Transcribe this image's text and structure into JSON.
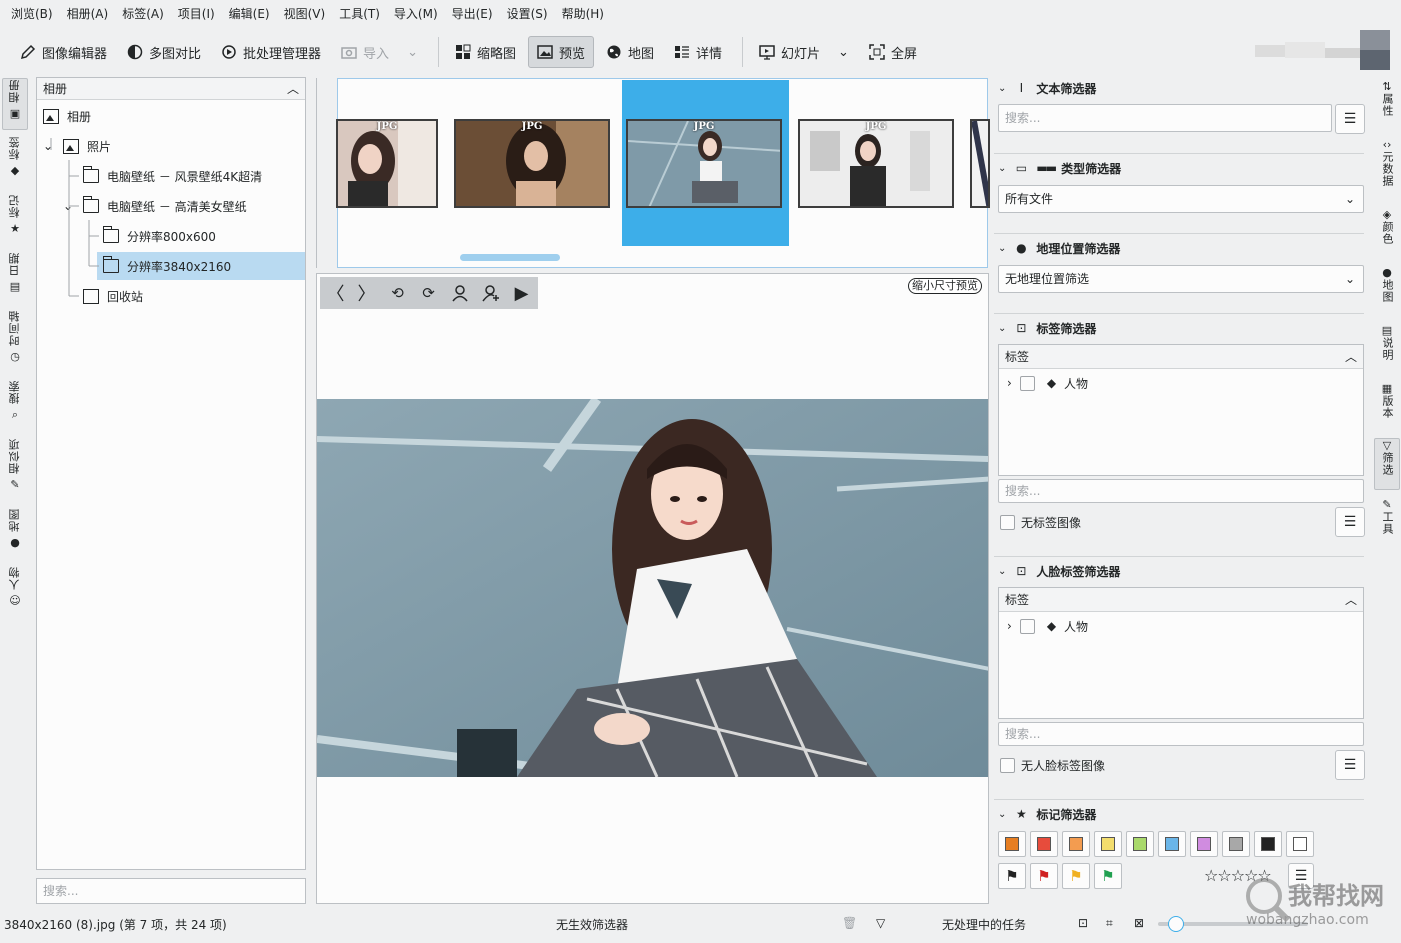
{
  "menubar": [
    "浏览(B)",
    "相册(A)",
    "标签(A)",
    "项目(I)",
    "编辑(E)",
    "视图(V)",
    "工具(T)",
    "导入(M)",
    "导出(E)",
    "设置(S)",
    "帮助(H)"
  ],
  "toolbar": {
    "image_editor": "图像编辑器",
    "light_table": "多图对比",
    "batch": "批处理管理器",
    "import": "导入",
    "thumbnails": "缩略图",
    "preview": "预览",
    "map": "地图",
    "details": "详情",
    "slideshow": "幻灯片",
    "fullscreen": "全屏"
  },
  "lefttabs": [
    "相册",
    "标签",
    "标记",
    "日期",
    "时间轴",
    "搜索",
    "相似项",
    "地图",
    "人物"
  ],
  "album": {
    "header": "相册",
    "root": "相册",
    "photos": "照片",
    "item1": "电脑壁纸 － 风景壁纸4K超清",
    "item2": "电脑壁纸 － 高清美女壁纸",
    "res1": "分辨率800x600",
    "res2": "分辨率3840x2160",
    "trash": "回收站",
    "search_placeholder": "搜索..."
  },
  "thumbs": {
    "badge": "JPG"
  },
  "preview": {
    "reduce_label": "缩小尺寸预览"
  },
  "filters": {
    "text": {
      "title": "文本筛选器",
      "placeholder": "搜索..."
    },
    "type": {
      "title": "类型筛选器",
      "value": "所有文件"
    },
    "geo": {
      "title": "地理位置筛选器",
      "value": "无地理位置筛选"
    },
    "tag": {
      "title": "标签筛选器",
      "col": "标签",
      "item": "人物",
      "placeholder": "搜索...",
      "untagged": "无标签图像"
    },
    "face": {
      "title": "人脸标签筛选器",
      "col": "标签",
      "item": "人物",
      "placeholder": "搜索...",
      "untagged": "无人脸标签图像"
    },
    "label": {
      "title": "标记筛选器"
    }
  },
  "colors": [
    "#e67e22",
    "#e74c3c",
    "#f39c50",
    "#f3dd6d",
    "#a9d96b",
    "#6ab5e8",
    "#d08ce0",
    "#a8a8a8",
    "#222222",
    "#ffffff"
  ],
  "flags": [
    "#222222",
    "#d02020",
    "#f0b020",
    "#20a050"
  ],
  "righttabs": [
    "属性",
    "元数据",
    "颜色",
    "地图",
    "说明",
    "版本",
    "筛选",
    "工具"
  ],
  "status": {
    "file": "3840x2160 (8).jpg (第 7 项，共 24 项)",
    "filter": "无生效筛选器",
    "tasks": "无处理中的任务"
  },
  "watermark": {
    "text": "我帮找网",
    "url": "wobangzhao.com"
  }
}
